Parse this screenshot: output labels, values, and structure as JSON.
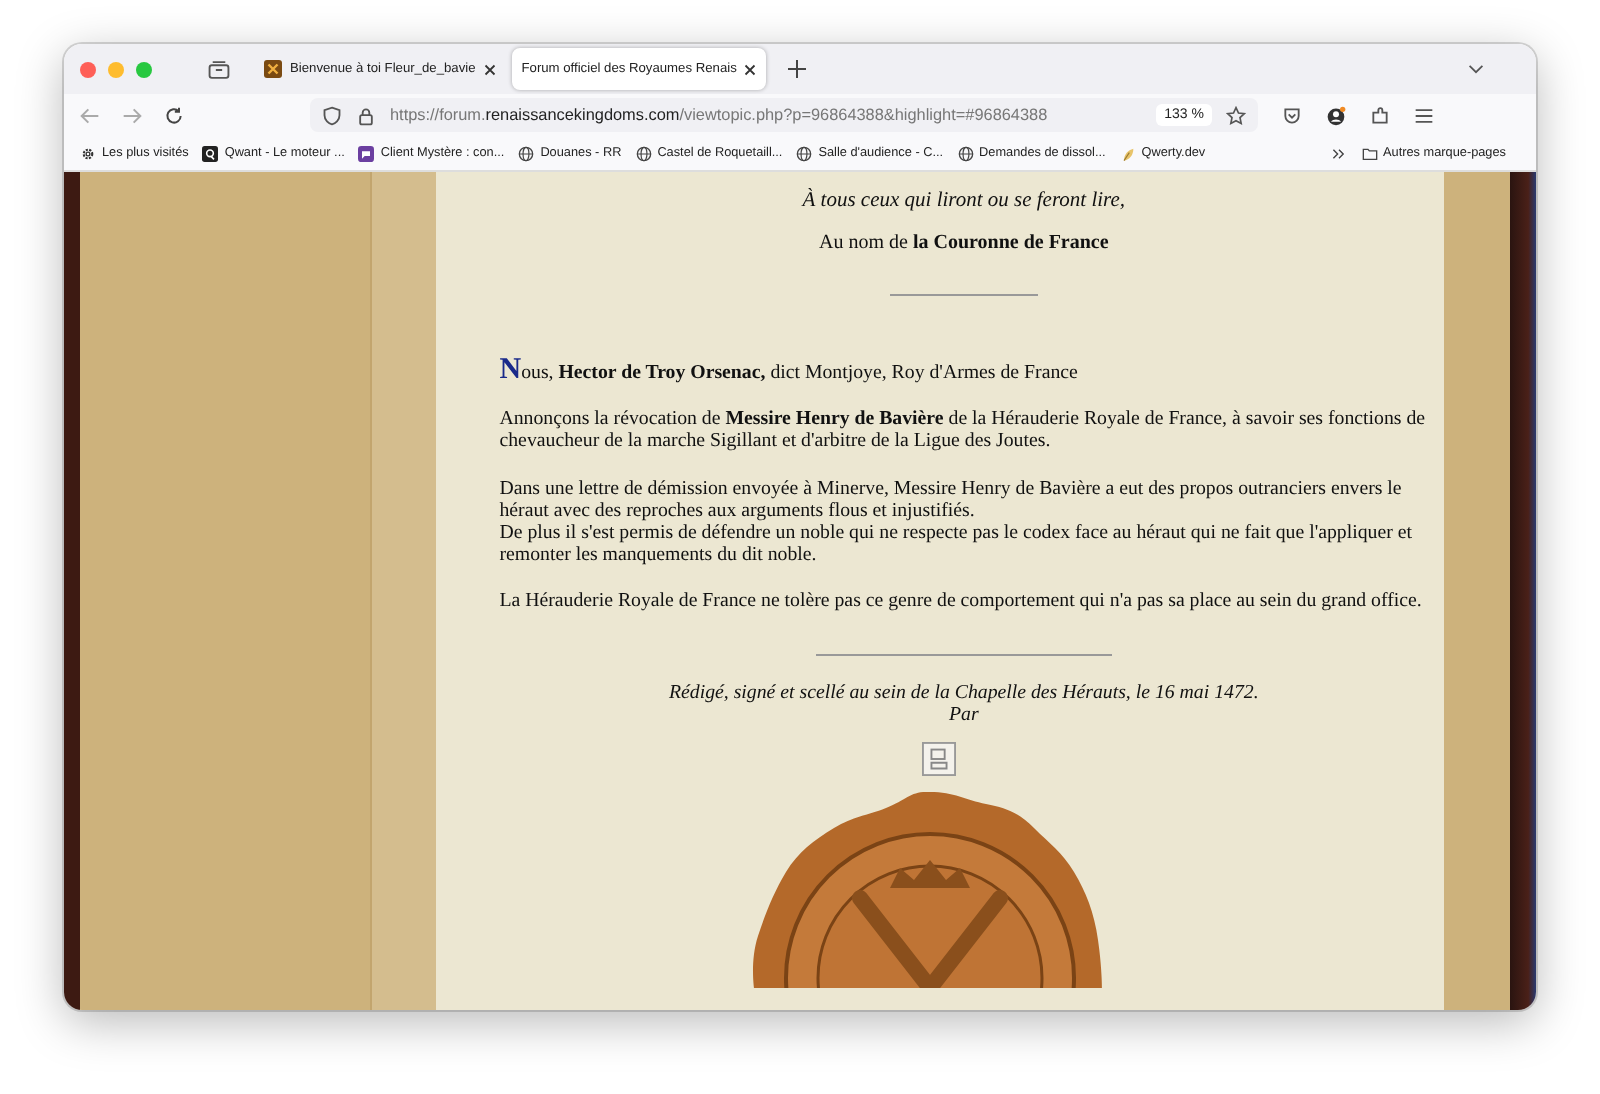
{
  "tabs": [
    {
      "title": "Bienvenue à toi Fleur_de_bavie",
      "selected": false
    },
    {
      "title": "Forum officiel des Royaumes Renais",
      "selected": true
    }
  ],
  "url": {
    "prefix": "https://forum.",
    "host": "renaissancekingdoms.com",
    "path": "/viewtopic.php?p=96864388&highlight=#96864388"
  },
  "zoom": "133 %",
  "bookmarks": [
    {
      "label": "Les plus visités",
      "kind": "gear"
    },
    {
      "label": "Qwant - Le moteur ...",
      "kind": "qwant"
    },
    {
      "label": "Client Mystère : con...",
      "kind": "chat"
    },
    {
      "label": "Douanes - RR",
      "kind": "globe"
    },
    {
      "label": "Castel de Roquetaill...",
      "kind": "globe"
    },
    {
      "label": "Salle d'audience - C...",
      "kind": "globe"
    },
    {
      "label": "Demandes de dissol...",
      "kind": "globe"
    },
    {
      "label": "Qwerty.dev",
      "kind": "leaf"
    }
  ],
  "other_bookmarks": "Autres marque-pages",
  "letter": {
    "address": "À tous ceux qui liront ou se feront lire,",
    "in_name": "Au nom de **la Couronne de France**",
    "initial": "N",
    "opening": "ous, **Hector de Troy Orsenac,** dict Montjoye, Roy d'Armes de France",
    "paragraphs": [
      [
        "Annonçons la révocation de **Messire Henry de Bavière** de la Hérauderie Royale de France, à savoir ses fonctions de chevaucheur de la marche Sigillant et d'arbitre de la Ligue des Joutes."
      ],
      [
        "Dans une lettre de démission envoyée à Minerve, Messire Henry de Bavière a eut des propos outranciers envers le héraut avec des reproches aux arguments flous et injustifiés.",
        "De plus il s'est permis de défendre un noble qui ne respecte pas le codex face au héraut qui ne fait que l'appliquer et remonter les manquements du dit noble."
      ],
      [
        "La Hérauderie Royale de France ne tolère pas ce genre de comportement qui n'a pas sa place au sein du grand office."
      ]
    ],
    "signature": "Rédigé, signé et scellé au sein de la Chapelle des Hérauts, le 16 mai 1472.",
    "by": "Par"
  }
}
